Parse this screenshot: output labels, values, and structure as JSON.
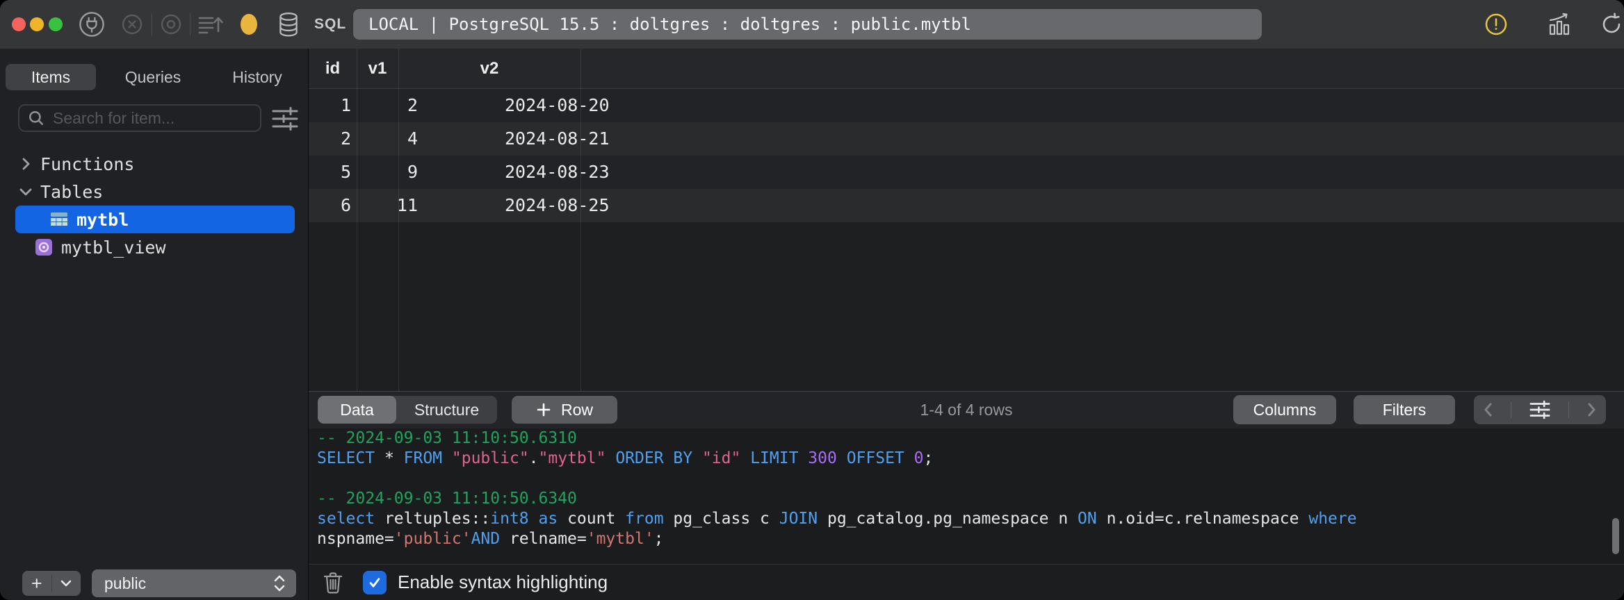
{
  "titlebar": {
    "title": "LOCAL | PostgreSQL 15.5 : doltgres : doltgres : public.mytbl",
    "sql_badge": "SQL",
    "status_color": "#eab53d",
    "warning_color": "#e9c43e"
  },
  "sidebar": {
    "tabs": [
      {
        "label": "Items",
        "selected": true
      },
      {
        "label": "Queries",
        "selected": false
      },
      {
        "label": "History",
        "selected": false
      }
    ],
    "search": {
      "placeholder": "Search for item..."
    },
    "tree": {
      "functions_label": "Functions",
      "tables_label": "Tables",
      "items": [
        {
          "label": "mytbl",
          "type": "table",
          "selected": true
        },
        {
          "label": "mytbl_view",
          "type": "view",
          "selected": false
        }
      ]
    },
    "schema_select": {
      "value": "public"
    },
    "add_button_label": "+"
  },
  "grid": {
    "columns": [
      "id",
      "v1",
      "v2"
    ],
    "rows": [
      [
        "1",
        "2",
        "2024-08-20"
      ],
      [
        "2",
        "4",
        "2024-08-21"
      ],
      [
        "5",
        "9",
        "2024-08-23"
      ],
      [
        "6",
        "11",
        "2024-08-25"
      ]
    ]
  },
  "toolbar": {
    "data_tab": "Data",
    "structure_tab": "Structure",
    "add_row_label": "Row",
    "row_count": "1-4 of 4 rows",
    "columns_label": "Columns",
    "filters_label": "Filters"
  },
  "sql_log": {
    "lines": [
      [
        {
          "t": "-- 2024-09-03 11:10:50.6310",
          "c": "c"
        }
      ],
      [
        {
          "t": "SELECT ",
          "c": "k"
        },
        {
          "t": "* ",
          "c": "w"
        },
        {
          "t": "FROM ",
          "c": "k"
        },
        {
          "t": "\"public\"",
          "c": "s"
        },
        {
          "t": ".",
          "c": "w"
        },
        {
          "t": "\"mytbl\"",
          "c": "s"
        },
        {
          "t": " ",
          "c": "w"
        },
        {
          "t": "ORDER BY ",
          "c": "k"
        },
        {
          "t": "\"id\"",
          "c": "s"
        },
        {
          "t": " ",
          "c": "w"
        },
        {
          "t": "LIMIT ",
          "c": "k"
        },
        {
          "t": "300 ",
          "c": "n"
        },
        {
          "t": "OFFSET ",
          "c": "k"
        },
        {
          "t": "0",
          "c": "n"
        },
        {
          "t": ";",
          "c": "w"
        }
      ],
      [],
      [
        {
          "t": "-- 2024-09-03 11:10:50.6340",
          "c": "c"
        }
      ],
      [
        {
          "t": "select ",
          "c": "k"
        },
        {
          "t": "reltuples::",
          "c": "w"
        },
        {
          "t": "int8 ",
          "c": "k"
        },
        {
          "t": "as ",
          "c": "k"
        },
        {
          "t": "count ",
          "c": "w"
        },
        {
          "t": "from ",
          "c": "k"
        },
        {
          "t": "pg_class c ",
          "c": "w"
        },
        {
          "t": "JOIN ",
          "c": "k"
        },
        {
          "t": "pg_catalog.pg_namespace n ",
          "c": "w"
        },
        {
          "t": "ON ",
          "c": "k"
        },
        {
          "t": "n.oid=c.relnamespace ",
          "c": "w"
        },
        {
          "t": "where",
          "c": "k"
        }
      ],
      [
        {
          "t": "nspname=",
          "c": "w"
        },
        {
          "t": "'public'",
          "c": "s2"
        },
        {
          "t": "AND ",
          "c": "k"
        },
        {
          "t": "relname=",
          "c": "w"
        },
        {
          "t": "'mytbl'",
          "c": "s2"
        },
        {
          "t": ";",
          "c": "w"
        }
      ]
    ]
  },
  "bottombar": {
    "syntax_checkbox": {
      "label": "Enable syntax highlighting",
      "checked": true
    }
  }
}
